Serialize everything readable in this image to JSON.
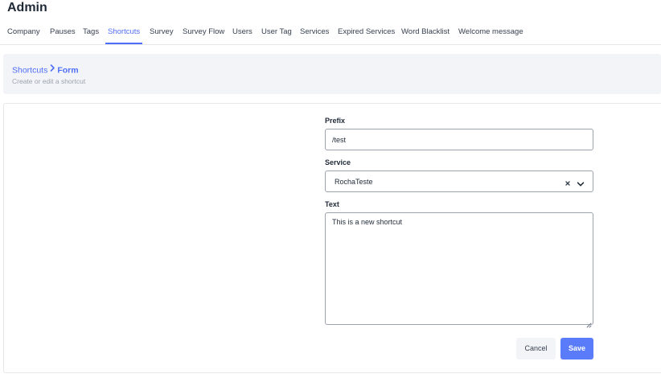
{
  "header": {
    "title": "Admin"
  },
  "tabs": [
    {
      "label": "Company"
    },
    {
      "label": "Pauses"
    },
    {
      "label": "Tags"
    },
    {
      "label": "Shortcuts",
      "active": true
    },
    {
      "label": "Survey"
    },
    {
      "label": "Survey Flow"
    },
    {
      "label": "Users"
    },
    {
      "label": "User Tag"
    },
    {
      "label": "Services"
    },
    {
      "label": "Expired Services"
    },
    {
      "label": "Word Blacklist"
    },
    {
      "label": "Welcome message"
    }
  ],
  "breadcrumb": {
    "parent": "Shortcuts",
    "separator_icon": "chevron-right-icon",
    "current": "Form",
    "subtitle": "Create or edit a shortcut"
  },
  "form": {
    "prefix": {
      "label": "Prefix",
      "value": "/test"
    },
    "service": {
      "label": "Service",
      "value": "RochaTeste",
      "clear_icon": "close-icon",
      "dropdown_icon": "chevron-down-icon"
    },
    "text": {
      "label": "Text",
      "value": "This is a new shortcut"
    },
    "cancel_label": "Cancel",
    "save_label": "Save"
  },
  "colors": {
    "accent": "#4f6ef7",
    "save_button": "#5b7cfa",
    "panel_background": "#f3f4f7",
    "border": "#9ca3af"
  }
}
